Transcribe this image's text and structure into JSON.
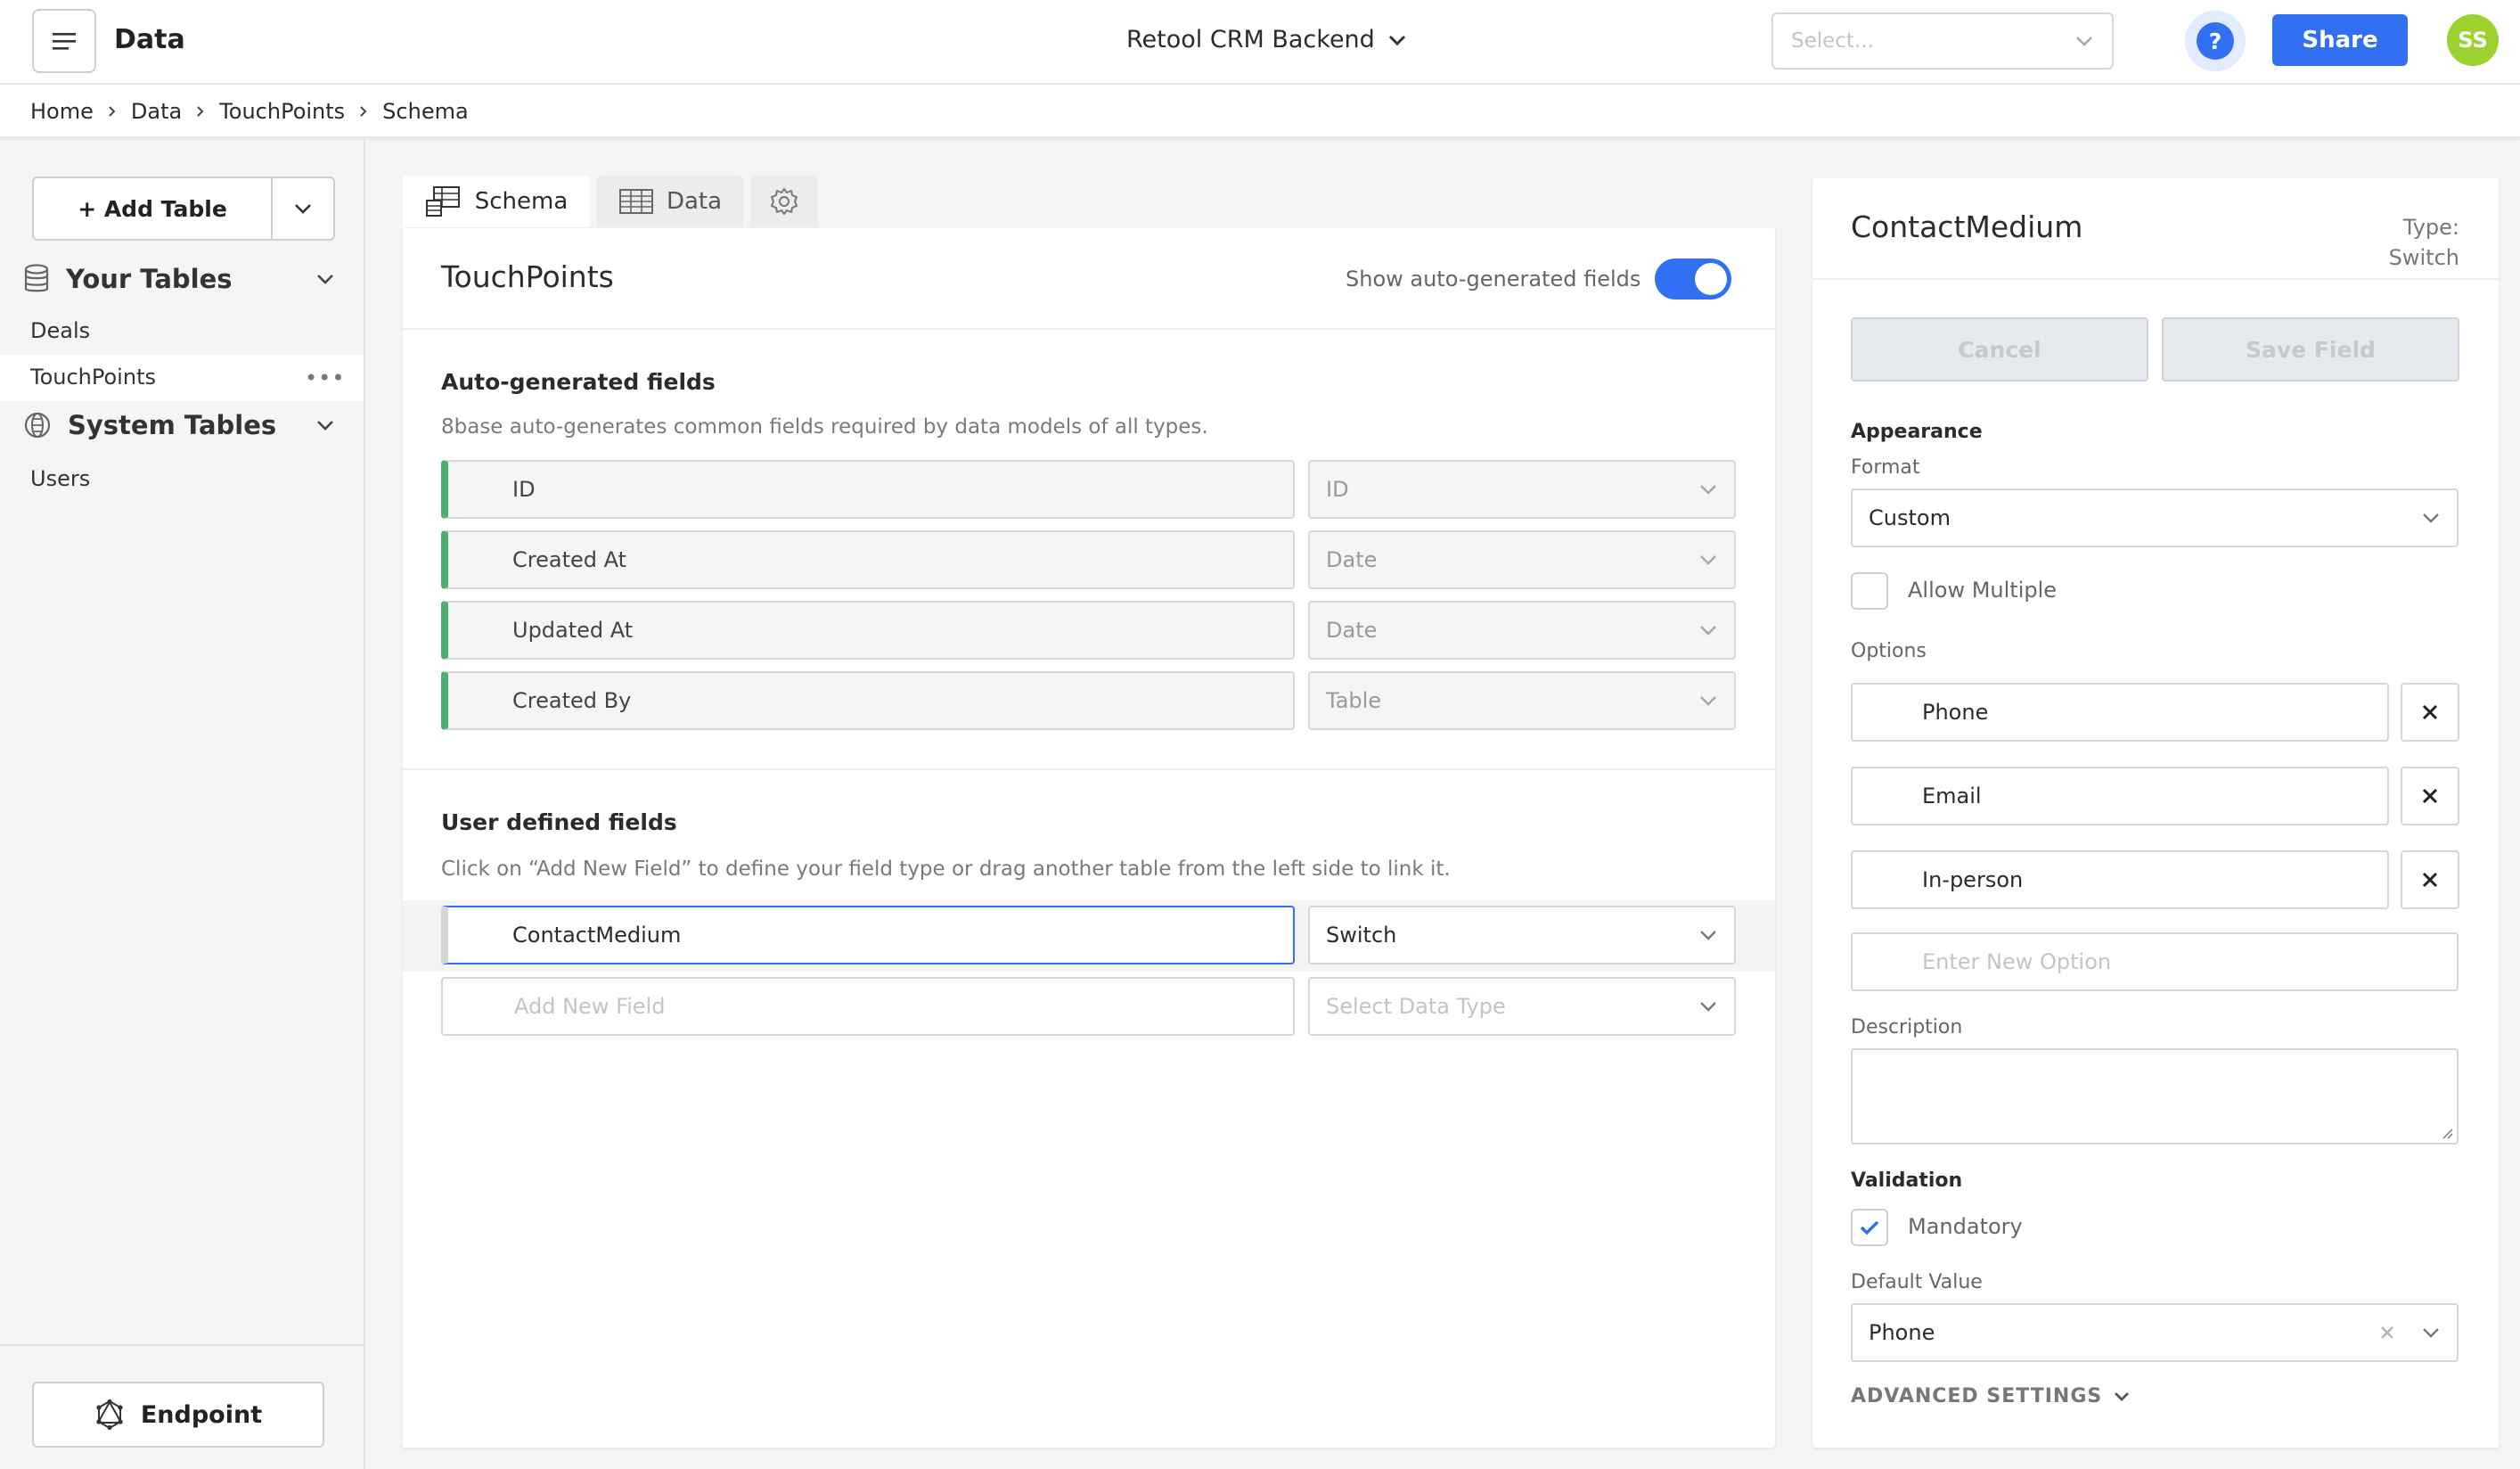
{
  "header": {
    "app_title": "Data",
    "resource_name": "Retool CRM Backend",
    "select_placeholder": "Select...",
    "help_label": "?",
    "share_label": "Share",
    "avatar_initials": "SS"
  },
  "breadcrumb": [
    "Home",
    "Data",
    "TouchPoints",
    "Schema"
  ],
  "sidebar": {
    "add_table_label": "+ Add Table",
    "your_tables": {
      "title": "Your Tables",
      "items": [
        "Deals",
        "TouchPoints"
      ]
    },
    "system_tables": {
      "title": "System Tables",
      "items": [
        "Users"
      ]
    },
    "endpoint_label": "Endpoint"
  },
  "tabs": [
    {
      "label": "Schema",
      "icon": "schema-icon",
      "active": true
    },
    {
      "label": "Data",
      "icon": "table-icon",
      "active": false
    },
    {
      "label": "",
      "icon": "gear-icon",
      "active": false
    }
  ],
  "schema": {
    "table_name": "TouchPoints",
    "toggle_label": "Show auto-generated fields",
    "toggle_on": true,
    "auto_section": {
      "title": "Auto-generated fields",
      "description": "8base auto-generates common fields required by data models of all types.",
      "fields": [
        {
          "name": "ID",
          "type": "ID"
        },
        {
          "name": "Created At",
          "type": "Date"
        },
        {
          "name": "Updated At",
          "type": "Date"
        },
        {
          "name": "Created By",
          "type": "Table"
        }
      ]
    },
    "user_section": {
      "title": "User defined fields",
      "description": "Click on “Add New Field” to define your field type or drag another table from the left side to link it.",
      "fields": [
        {
          "name": "ContactMedium",
          "type": "Switch"
        }
      ],
      "new_field_placeholder": "Add New Field",
      "new_type_placeholder": "Select Data Type"
    },
    "accent_auto": "#4caf6e",
    "accent_primary": "#3170f2"
  },
  "field_panel": {
    "title": "ContactMedium",
    "type_label": "Type: Switch",
    "cancel_label": "Cancel",
    "save_label": "Save Field",
    "appearance_title": "Appearance",
    "format_label": "Format",
    "format_value": "Custom",
    "allow_multiple_label": "Allow Multiple",
    "allow_multiple_checked": false,
    "options_label": "Options",
    "options": [
      "Phone",
      "Email",
      "In-person"
    ],
    "new_option_placeholder": "Enter New Option",
    "description_label": "Description",
    "validation_title": "Validation",
    "mandatory_label": "Mandatory",
    "mandatory_checked": true,
    "default_value_label": "Default Value",
    "default_value": "Phone",
    "advanced_label": "ADVANCED SETTINGS"
  }
}
